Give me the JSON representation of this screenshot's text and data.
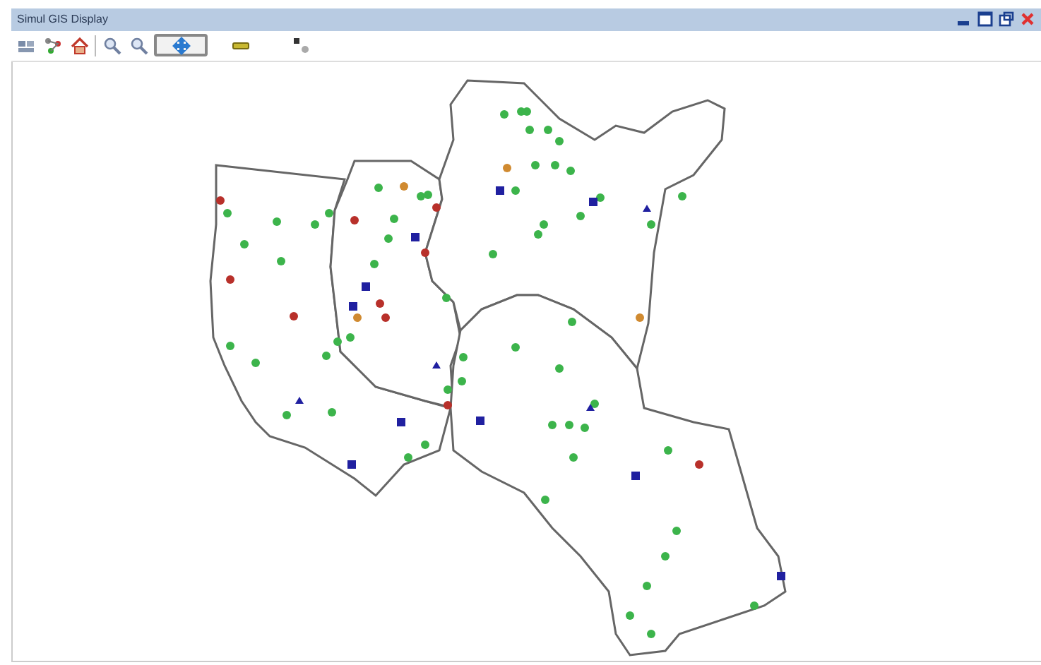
{
  "window": {
    "title": "Simul GIS Display"
  },
  "toolbar": [
    {
      "kind": "layers",
      "selected": false
    },
    {
      "kind": "tree",
      "selected": false
    },
    {
      "kind": "home",
      "selected": false
    },
    {
      "kind": "zoom-in",
      "selected": false
    },
    {
      "kind": "zoom-out",
      "selected": false
    },
    {
      "kind": "pan",
      "selected": true
    },
    {
      "kind": "measure",
      "selected": false
    },
    {
      "kind": "identify",
      "selected": false
    }
  ]
}
